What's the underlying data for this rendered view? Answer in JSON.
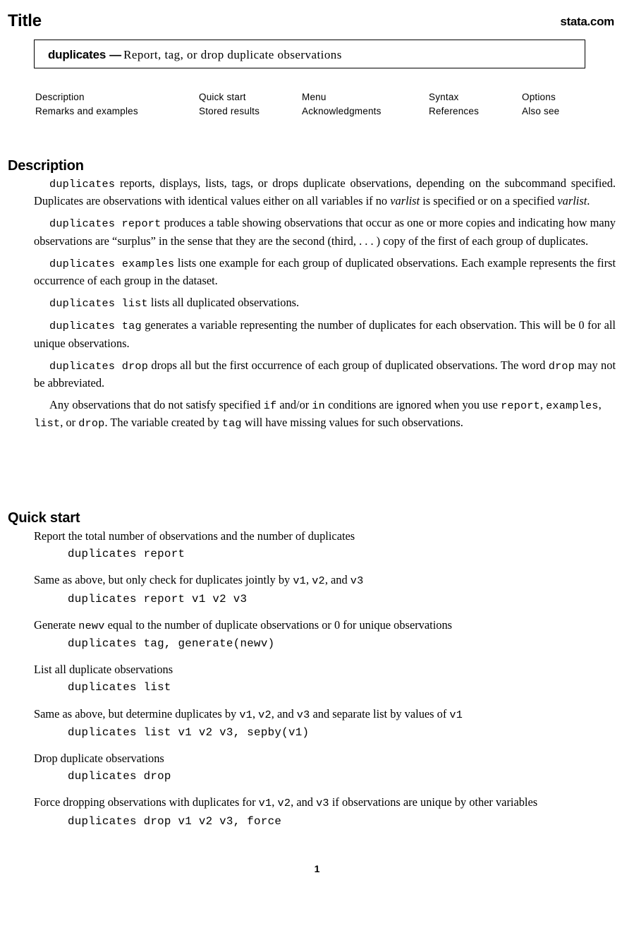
{
  "header": {
    "title": "Title",
    "brand": "stata.com"
  },
  "title_box": {
    "command": "duplicates",
    "dash": "—",
    "description": "Report, tag, or drop duplicate observations"
  },
  "nav": {
    "columns": [
      {
        "items": [
          "Description",
          "Remarks and examples"
        ]
      },
      {
        "items": [
          "Quick start",
          "Stored results"
        ]
      },
      {
        "items": [
          "Menu",
          "Acknowledgments"
        ]
      },
      {
        "items": [
          "Syntax",
          "References"
        ]
      },
      {
        "items": [
          "Options",
          "Also see"
        ]
      }
    ]
  },
  "sections": {
    "description": {
      "heading": "Description",
      "paragraphs": [
        {
          "id": "p1",
          "runs": [
            {
              "t": "duplicates",
              "s": "mono"
            },
            {
              "t": " reports, displays, lists, tags, or drops duplicate observations, depending on the subcommand specified. Duplicates are observations with identical values either on all variables if no ",
              "s": "serif"
            },
            {
              "t": "varlist",
              "s": "italic"
            },
            {
              "t": " is specified or on a specified ",
              "s": "serif"
            },
            {
              "t": "varlist",
              "s": "italic"
            },
            {
              "t": ".",
              "s": "serif"
            }
          ]
        },
        {
          "id": "p2",
          "runs": [
            {
              "t": "duplicates report",
              "s": "mono"
            },
            {
              "t": " produces a table showing observations that occur as one or more copies and indicating how many observations are “surplus” in the sense that they are the second (third, . . . ) copy of the first of each group of duplicates.",
              "s": "serif"
            }
          ]
        },
        {
          "id": "p3",
          "runs": [
            {
              "t": "duplicates examples",
              "s": "mono"
            },
            {
              "t": " lists one example for each group of duplicated observations. Each example represents the first occurrence of each group in the dataset.",
              "s": "serif"
            }
          ]
        },
        {
          "id": "p4",
          "runs": [
            {
              "t": "duplicates list",
              "s": "mono"
            },
            {
              "t": " lists all duplicated observations.",
              "s": "serif"
            }
          ]
        },
        {
          "id": "p5",
          "runs": [
            {
              "t": "duplicates tag",
              "s": "mono"
            },
            {
              "t": " generates a variable representing the number of duplicates for each observation. This will be 0 for all unique observations.",
              "s": "serif"
            }
          ]
        },
        {
          "id": "p6",
          "runs": [
            {
              "t": "duplicates drop",
              "s": "mono"
            },
            {
              "t": " drops all but the first occurrence of each group of duplicated observations. The word ",
              "s": "serif"
            },
            {
              "t": "drop",
              "s": "mono"
            },
            {
              "t": " may not be abbreviated.",
              "s": "serif"
            }
          ]
        },
        {
          "id": "p7",
          "runs": [
            {
              "t": "Any observations that do not satisfy specified ",
              "s": "serif"
            },
            {
              "t": "if",
              "s": "mono"
            },
            {
              "t": " and/or ",
              "s": "serif"
            },
            {
              "t": "in",
              "s": "mono"
            },
            {
              "t": " conditions are ignored when you use ",
              "s": "serif"
            },
            {
              "t": "report",
              "s": "mono"
            },
            {
              "t": ", ",
              "s": "serif"
            },
            {
              "t": "examples",
              "s": "mono"
            },
            {
              "t": ", ",
              "s": "serif"
            },
            {
              "t": "list",
              "s": "mono"
            },
            {
              "t": ", or ",
              "s": "serif"
            },
            {
              "t": "drop",
              "s": "mono"
            },
            {
              "t": ". The variable created by ",
              "s": "serif"
            },
            {
              "t": "tag",
              "s": "mono"
            },
            {
              "t": " will have missing values for such observations.",
              "s": "serif"
            }
          ]
        }
      ]
    },
    "quick_start": {
      "heading": "Quick start",
      "items": [
        {
          "desc_runs": [
            {
              "t": "Report the total number of observations and the number of duplicates",
              "s": "serif"
            }
          ],
          "code": "duplicates report"
        },
        {
          "desc_runs": [
            {
              "t": "Same as above, but only check for duplicates jointly by ",
              "s": "serif"
            },
            {
              "t": "v1",
              "s": "mono"
            },
            {
              "t": ", ",
              "s": "serif"
            },
            {
              "t": "v2",
              "s": "mono"
            },
            {
              "t": ", and ",
              "s": "serif"
            },
            {
              "t": "v3",
              "s": "mono"
            }
          ],
          "code": "duplicates report v1 v2 v3"
        },
        {
          "desc_runs": [
            {
              "t": "Generate ",
              "s": "serif"
            },
            {
              "t": "newv",
              "s": "mono"
            },
            {
              "t": " equal to the number of duplicate observations or 0 for unique observations",
              "s": "serif"
            }
          ],
          "code": "duplicates tag, generate(newv)"
        },
        {
          "desc_runs": [
            {
              "t": "List all duplicate observations",
              "s": "serif"
            }
          ],
          "code": "duplicates list"
        },
        {
          "desc_runs": [
            {
              "t": "Same as above, but determine duplicates by ",
              "s": "serif"
            },
            {
              "t": "v1",
              "s": "mono"
            },
            {
              "t": ", ",
              "s": "serif"
            },
            {
              "t": "v2",
              "s": "mono"
            },
            {
              "t": ", and ",
              "s": "serif"
            },
            {
              "t": "v3",
              "s": "mono"
            },
            {
              "t": " and separate list by values of ",
              "s": "serif"
            },
            {
              "t": "v1",
              "s": "mono"
            }
          ],
          "code": "duplicates list v1 v2 v3, sepby(v1)"
        },
        {
          "desc_runs": [
            {
              "t": "Drop duplicate observations",
              "s": "serif"
            }
          ],
          "code": "duplicates drop"
        },
        {
          "desc_runs": [
            {
              "t": "Force dropping observations with duplicates for ",
              "s": "serif"
            },
            {
              "t": "v1",
              "s": "mono"
            },
            {
              "t": ", ",
              "s": "serif"
            },
            {
              "t": "v2",
              "s": "mono"
            },
            {
              "t": ", and ",
              "s": "serif"
            },
            {
              "t": "v3",
              "s": "mono"
            },
            {
              "t": " if observations are unique by other variables",
              "s": "serif"
            }
          ],
          "code": "duplicates drop v1 v2 v3, force"
        }
      ]
    }
  },
  "footer": {
    "page_number": "1"
  }
}
